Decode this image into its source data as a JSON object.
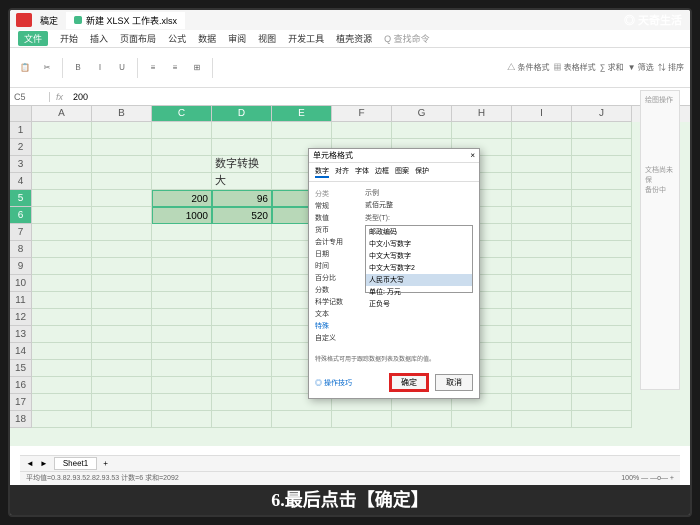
{
  "brand": "天奇生活",
  "titlebar": {
    "home": "稿定",
    "file": "新建 XLSX 工作表.xlsx"
  },
  "menu": [
    "三 文件",
    "开始",
    "插入",
    "页面布局",
    "公式",
    "数据",
    "审阅",
    "视图",
    "开发工具",
    "植壳资源",
    "Q 查找命令"
  ],
  "file_btn": "文件",
  "toolbar_right": [
    "△ 条件格式",
    "▦ 表格样式",
    "∑ 求和",
    "▼ 筛选",
    "⇅ 排序",
    "▦",
    "⊞",
    "▤",
    "⊡",
    "▦"
  ],
  "fx": {
    "name": "C5",
    "label": "fx",
    "value": "200"
  },
  "cols": [
    "",
    "A",
    "B",
    "C",
    "D",
    "E",
    "F",
    "G",
    "H",
    "I",
    "J"
  ],
  "sel_cols": [
    3,
    4,
    5
  ],
  "rows": [
    1,
    2,
    3,
    4,
    5,
    6,
    7,
    8,
    9,
    10,
    11,
    12,
    13,
    14,
    15,
    16,
    17,
    18
  ],
  "sel_rows": [
    5,
    6
  ],
  "cells": {
    "title": "数字转换大",
    "c5": "200",
    "d5": "96",
    "c6": "1000",
    "d6": "520"
  },
  "sheet_tab": "Sheet1",
  "status_left": "平均值=0.3.82.93.52.82.93.53  计数=6  求和=2092",
  "status_right": "100% — —o— +",
  "rightpane": {
    "title": "绘图操作",
    "p1": "文档尚未保",
    "p2": "备份中"
  },
  "dialog": {
    "title": "单元格格式",
    "close": "×",
    "tabs": [
      "数字",
      "对齐",
      "字体",
      "边框",
      "图案",
      "保护"
    ],
    "cat_label": "分类",
    "cats": [
      "常规",
      "数值",
      "货币",
      "会计专用",
      "日期",
      "时间",
      "百分比",
      "分数",
      "科学记数",
      "文本",
      "特殊",
      "自定义"
    ],
    "active_cat": "特殊",
    "sample_label": "示例",
    "sample_value": "贰佰元整",
    "type_label": "类型(T):",
    "types": [
      "邮政编码",
      "中文小写数字",
      "中文大写数字",
      "中文大写数字2",
      "人民币大写",
      "单位: 万元",
      "正负号"
    ],
    "sel_type": "人民币大写",
    "desc": "特殊格式可用于跟踪数据列表及数据库的值。",
    "link": "◎ 操作技巧",
    "ok": "确定",
    "cancel": "取消"
  },
  "caption": "6.最后点击【确定】",
  "chart_data": {
    "type": "table",
    "title": "数字转换大",
    "columns": [
      "C",
      "D"
    ],
    "rows": [
      {
        "C": 200,
        "D": 96
      },
      {
        "C": 1000,
        "D": 520
      }
    ]
  }
}
